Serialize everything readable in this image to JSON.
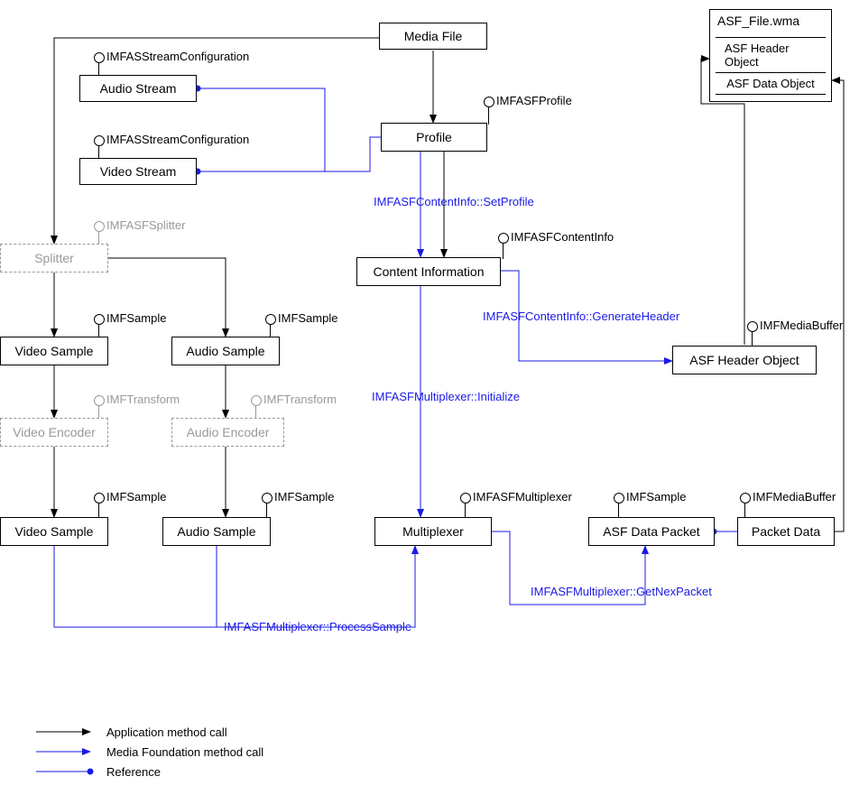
{
  "boxes": {
    "media_file": "Media File",
    "audio_stream": "Audio Stream",
    "video_stream": "Video Stream",
    "profile": "Profile",
    "splitter": "Splitter",
    "content_info": "Content Information",
    "video_sample_1": "Video Sample",
    "audio_sample_1": "Audio Sample",
    "video_encoder": "Video Encoder",
    "audio_encoder": "Audio Encoder",
    "video_sample_2": "Video Sample",
    "audio_sample_2": "Audio Sample",
    "multiplexer": "Multiplexer",
    "asf_data_packet": "ASF Data Packet",
    "packet_data": "Packet Data",
    "asf_header_object": "ASF Header Object"
  },
  "interfaces": {
    "audio_stream_cfg": "IMFASStreamConfiguration",
    "video_stream_cfg": "IMFASStreamConfiguration",
    "profile": "IMFASFProfile",
    "splitter": "IMFASFSplitter",
    "content_info": "IMFASFContentInfo",
    "video_sample_1": "IMFSample",
    "audio_sample_1": "IMFSample",
    "video_encoder": "IMFTransform",
    "audio_encoder": "IMFTransform",
    "video_sample_2": "IMFSample",
    "audio_sample_2": "IMFSample",
    "multiplexer": "IMFASFMultiplexer",
    "asf_data_packet": "IMFSample",
    "packet_data": "IMFMediaBuffer",
    "asf_header_object": "IMFMediaBuffer"
  },
  "methods": {
    "set_profile": "IMFASFContentInfo::SetProfile",
    "generate_header": "IMFASFContentInfo::GenerateHeader",
    "initialize": "IMFASFMultiplexer::Initialize",
    "process_sample": "IMFASFMultiplexer::ProcessSample",
    "get_next_packet": "IMFASFMultiplexer::GetNexPacket"
  },
  "file": {
    "title": "ASF_File.wma",
    "header": "ASF Header Object",
    "data": "ASF Data Object"
  },
  "legend": {
    "app_call": "Application method call",
    "mf_call": "Media Foundation method call",
    "reference": "Reference"
  }
}
